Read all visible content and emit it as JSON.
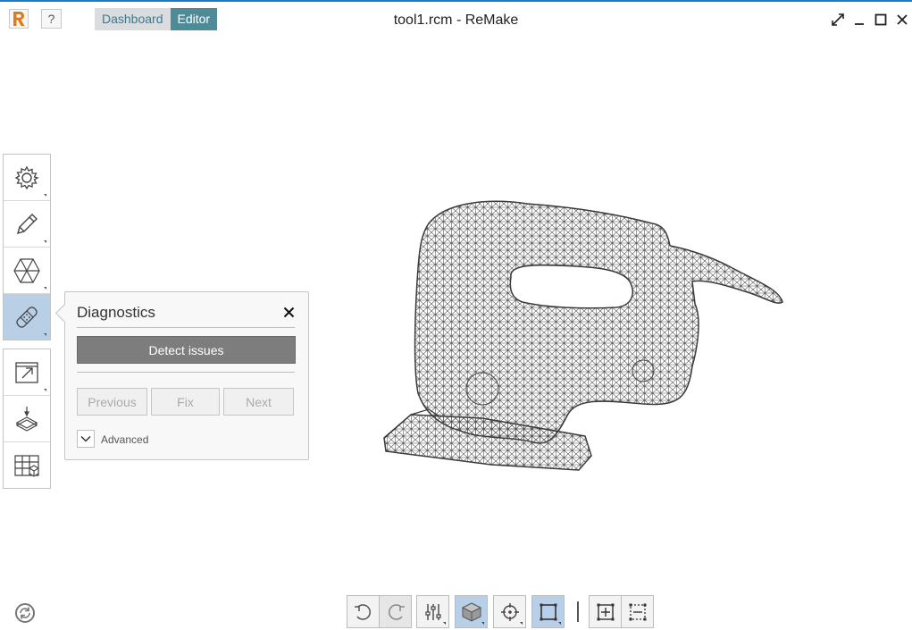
{
  "window": {
    "title": "tool1.rcm - ReMake",
    "help_label": "?",
    "modes": {
      "dashboard": "Dashboard",
      "editor": "Editor"
    },
    "accent_color": "#4f8a98",
    "brand_color": "#e07b1a"
  },
  "left_toolbar": {
    "group1": [
      {
        "icon": "gear-icon",
        "active": false
      },
      {
        "icon": "pencil-icon",
        "active": false
      },
      {
        "icon": "hexagon-icon",
        "active": false
      },
      {
        "icon": "bandage-icon",
        "active": true
      }
    ],
    "group2": [
      {
        "icon": "export-icon"
      },
      {
        "icon": "print-3d-icon"
      },
      {
        "icon": "grid-cube-icon"
      }
    ]
  },
  "diagnostics": {
    "title": "Diagnostics",
    "detect_label": "Detect issues",
    "previous_label": "Previous",
    "fix_label": "Fix",
    "next_label": "Next",
    "advanced_label": "Advanced"
  },
  "bottom_toolbar": {
    "buttons": [
      "undo-icon",
      "redo-icon",
      "sliders-icon",
      "shaded-cube-icon",
      "crosshair-icon",
      "square-select-icon",
      "fit-view-icon",
      "dashed-select-icon"
    ]
  }
}
